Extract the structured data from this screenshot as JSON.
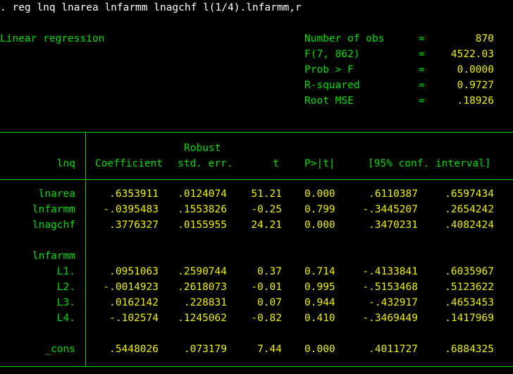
{
  "command": ". reg lnq lnarea lnfarmm lnagchf l(1/4).lnfarmm,r",
  "title": "Linear regression",
  "stats": [
    {
      "label": "Number of obs",
      "eq": "=",
      "value": "870"
    },
    {
      "label": "F(7, 862)",
      "eq": "=",
      "value": "4522.03"
    },
    {
      "label": "Prob > F",
      "eq": "=",
      "value": "0.0000"
    },
    {
      "label": "R-squared",
      "eq": "=",
      "value": "0.9727"
    },
    {
      "label": "Root MSE",
      "eq": "=",
      "value": ".18926"
    }
  ],
  "header": {
    "depvar": "lnq",
    "coef": "Coefficient",
    "robust": "Robust",
    "se": "std. err.",
    "t": "t",
    "p": "P>|t|",
    "ci": "[95% conf. interval]"
  },
  "rows": [
    {
      "name": "lnarea",
      "coef": ".6353911",
      "se": ".0124074",
      "t": "51.21",
      "p": "0.000",
      "lo": ".6110387",
      "hi": ".6597434"
    },
    {
      "name": "lnfarmm",
      "coef": "-.0395483",
      "se": ".1553826",
      "t": "-0.25",
      "p": "0.799",
      "lo": "-.3445207",
      "hi": ".2654242"
    },
    {
      "name": "lnagchf",
      "coef": ".3776327",
      "se": ".0155955",
      "t": "24.21",
      "p": "0.000",
      "lo": ".3470231",
      "hi": ".4082424"
    }
  ],
  "group": {
    "name": "lnfarmm",
    "rows": [
      {
        "name": "L1.",
        "coef": ".0951063",
        "se": ".2590744",
        "t": "0.37",
        "p": "0.714",
        "lo": "-.4133841",
        "hi": ".6035967"
      },
      {
        "name": "L2.",
        "coef": "-.0014923",
        "se": ".2618073",
        "t": "-0.01",
        "p": "0.995",
        "lo": "-.5153468",
        "hi": ".5123622"
      },
      {
        "name": "L3.",
        "coef": ".0162142",
        "se": ".228831",
        "t": "0.07",
        "p": "0.944",
        "lo": "-.432917",
        "hi": ".4653453"
      },
      {
        "name": "L4.",
        "coef": "-.102574",
        "se": ".1245062",
        "t": "-0.82",
        "p": "0.410",
        "lo": "-.3469449",
        "hi": ".1417969"
      }
    ]
  },
  "cons": {
    "name": "_cons",
    "coef": ".5448026",
    "se": ".073179",
    "t": "7.44",
    "p": "0.000",
    "lo": ".4011727",
    "hi": ".6884325"
  },
  "colors": {
    "background": "#000000",
    "command": "#ffffff",
    "label": "#00e000",
    "value": "#f0f000"
  }
}
